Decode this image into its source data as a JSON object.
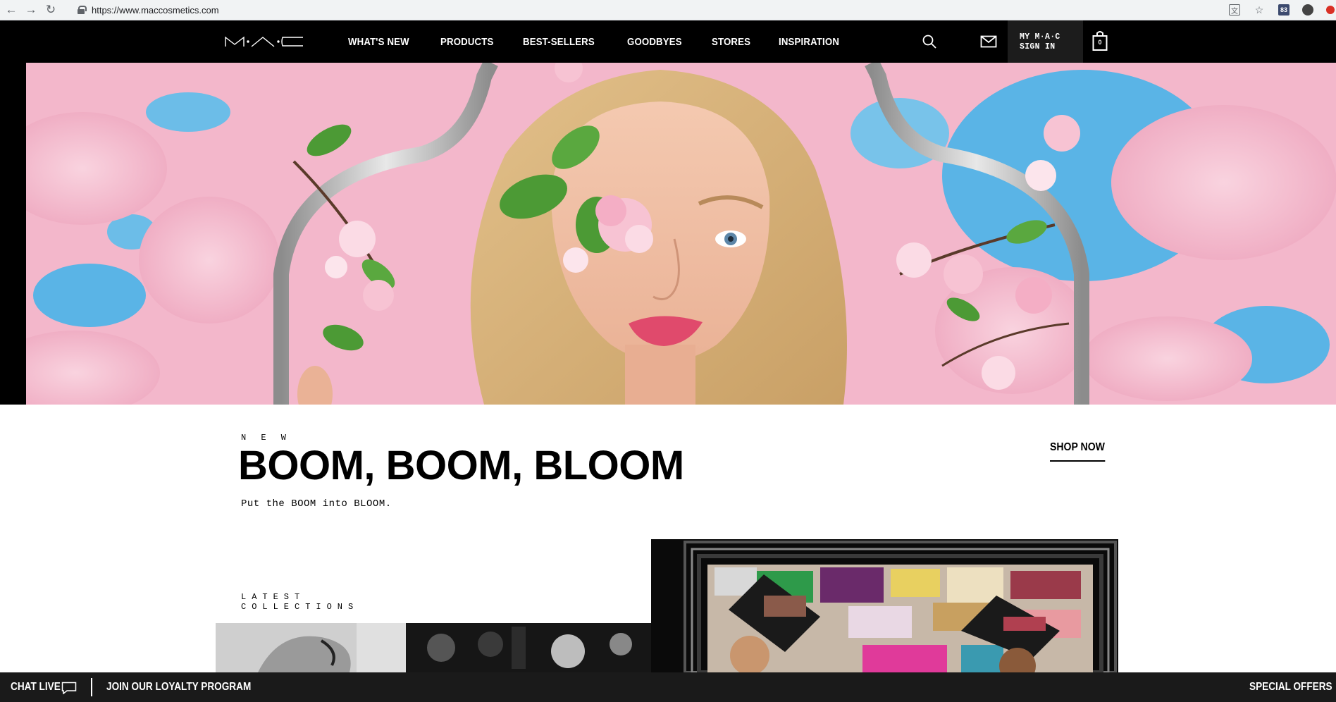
{
  "browser": {
    "url": "https://www.maccosmetics.com",
    "badge_count": "83"
  },
  "header": {
    "logo_alt": "M·A·C",
    "nav": [
      {
        "label": "WHAT'S NEW"
      },
      {
        "label": "PRODUCTS"
      },
      {
        "label": "BEST-SELLERS"
      },
      {
        "label": "GOODBYES"
      },
      {
        "label": "STORES"
      },
      {
        "label": "INSPIRATION"
      }
    ],
    "my_mac_line1": "MY M·A·C",
    "my_mac_line2": "SIGN IN",
    "bag_count": "0"
  },
  "hero": {
    "eyebrow": "N E W",
    "title": "BOOM, BOOM, BLOOM",
    "subtitle": "Put the BOOM into BLOOM.",
    "cta": "SHOP NOW"
  },
  "latest": {
    "line1": "LATEST",
    "line2": "COLLECTIONS"
  },
  "bottom_bar": {
    "chat": "CHAT LIVE",
    "loyalty": "JOIN OUR LOYALTY PROGRAM",
    "offers": "SPECIAL OFFERS"
  },
  "colors": {
    "header_bg": "#000000",
    "sky_pink": "#f2b8cc",
    "sky_blue": "#5ab4e6",
    "frame_silver": "#b8b8b8"
  }
}
